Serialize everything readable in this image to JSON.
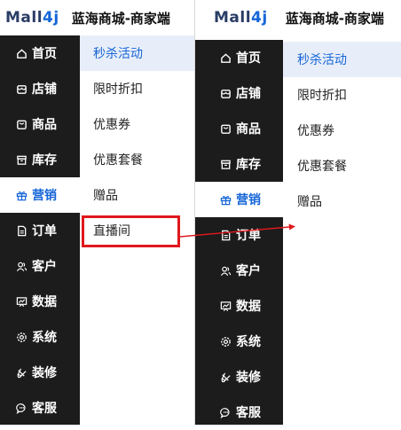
{
  "colors": {
    "accent": "#1565d8",
    "sidebar_bg": "#1c1c1c",
    "highlight": "#e0181d",
    "active_sub_bg": "#e8eef9"
  },
  "header": {
    "logo_main": "Mall",
    "logo_num": "4j",
    "store_name": "蓝海商城-商家端"
  },
  "sidebar": {
    "items": [
      {
        "label": "首页",
        "icon": "home-icon"
      },
      {
        "label": "店铺",
        "icon": "shop-icon"
      },
      {
        "label": "商品",
        "icon": "product-icon"
      },
      {
        "label": "库存",
        "icon": "inventory-icon"
      },
      {
        "label": "营销",
        "icon": "gift-icon"
      },
      {
        "label": "订单",
        "icon": "order-icon"
      },
      {
        "label": "客户",
        "icon": "customer-icon"
      },
      {
        "label": "数据",
        "icon": "data-icon"
      },
      {
        "label": "系统",
        "icon": "settings-icon"
      },
      {
        "label": "装修",
        "icon": "decorate-icon"
      },
      {
        "label": "客服",
        "icon": "service-icon"
      }
    ],
    "active": "营销"
  },
  "submenu_before": [
    "秒杀活动",
    "限时折扣",
    "优惠券",
    "优惠套餐",
    "赠品",
    "直播间"
  ],
  "submenu_after": [
    "秒杀活动",
    "限时折扣",
    "优惠券",
    "优惠套餐",
    "赠品"
  ]
}
